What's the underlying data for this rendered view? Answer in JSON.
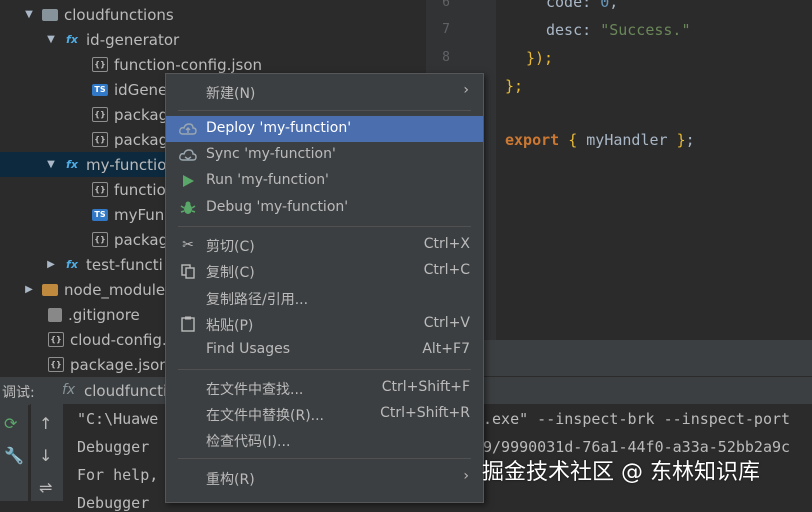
{
  "tree": {
    "items": [
      {
        "label": "cloudfunctions",
        "icon": "folder-icon"
      },
      {
        "label": "id-generator",
        "icon": "function-icon"
      },
      {
        "label": "function-config.json",
        "icon": "json-file-icon"
      },
      {
        "label": "idGene",
        "icon": "typescript-file-icon"
      },
      {
        "label": "packag",
        "icon": "json-file-icon"
      },
      {
        "label": "packag",
        "icon": "json-file-icon"
      },
      {
        "label": "my-functio",
        "icon": "function-icon"
      },
      {
        "label": "functio",
        "icon": "json-file-icon"
      },
      {
        "label": "myFunc",
        "icon": "typescript-file-icon"
      },
      {
        "label": "packag",
        "icon": "json-file-icon"
      },
      {
        "label": "test-functi",
        "icon": "function-icon"
      },
      {
        "label": "node_module",
        "icon": "folder-icon"
      },
      {
        "label": ".gitignore",
        "icon": "git-file-icon"
      },
      {
        "label": "cloud-config.",
        "icon": "json-file-icon"
      },
      {
        "label": "package.json",
        "icon": "json-file-icon"
      }
    ],
    "icon_glyphs": {
      "fx": "fx",
      "ts": "TS",
      "json": "{}"
    }
  },
  "editor": {
    "line_numbers": [
      "6",
      "7",
      "8"
    ],
    "lines": {
      "l1_key": "code:",
      "l1_val": "0",
      "l1_end": ",",
      "l2_key": "desc:",
      "l2_val": "\"Success.\"",
      "l3": "});",
      "l4": "};",
      "l5_kw": "export",
      "l5_open": "{",
      "l5_name": "myHandler",
      "l5_close": "}",
      "l5_end": ";"
    }
  },
  "debug_panel": {
    "label": "调试:",
    "tab_icon": "fx",
    "tab": "cloudfuncti",
    "console_lines": [
      "\"C:\\Huawe",
      "Debugger",
      "For help,",
      "Debugger"
    ],
    "console_right": [
      ".exe\" --inspect-brk --inspect-port",
      "9/9990031d-76a1-44f0-a33a-52bb2a9c"
    ]
  },
  "context_menu": {
    "items": [
      {
        "label": "新建(N)",
        "shortcut": "",
        "submenu": true,
        "icon": ""
      },
      {
        "label": "Deploy 'my-function'",
        "shortcut": "",
        "icon": "cloud-upload-icon",
        "active": true
      },
      {
        "label": "Sync 'my-function'",
        "shortcut": "",
        "icon": "cloud-sync-icon"
      },
      {
        "label": "Run 'my-function'",
        "shortcut": "",
        "icon": "run-icon"
      },
      {
        "label": "Debug 'my-function'",
        "shortcut": "",
        "icon": "debug-icon"
      },
      {
        "label": "剪切(C)",
        "shortcut": "Ctrl+X",
        "icon": "cut-icon"
      },
      {
        "label": "复制(C)",
        "shortcut": "Ctrl+C",
        "icon": "copy-icon"
      },
      {
        "label": "复制路径/引用...",
        "shortcut": "",
        "icon": ""
      },
      {
        "label": "粘贴(P)",
        "shortcut": "Ctrl+V",
        "icon": "paste-icon"
      },
      {
        "label": "Find Usages",
        "shortcut": "Alt+F7",
        "icon": ""
      },
      {
        "label": "在文件中查找...",
        "shortcut": "Ctrl+Shift+F",
        "icon": ""
      },
      {
        "label": "在文件中替换(R)...",
        "shortcut": "Ctrl+Shift+R",
        "icon": ""
      },
      {
        "label": "检查代码(I)...",
        "shortcut": "",
        "icon": ""
      },
      {
        "label": "重构(R)",
        "shortcut": "",
        "submenu": true,
        "icon": ""
      }
    ],
    "submenu_glyph": "›"
  },
  "watermark": "掘金技术社区 @ 东林知识库",
  "colors": {
    "selection": "#4b6eaf",
    "tree_selected": "#0d293e",
    "menu_bg": "#3c3f41"
  }
}
